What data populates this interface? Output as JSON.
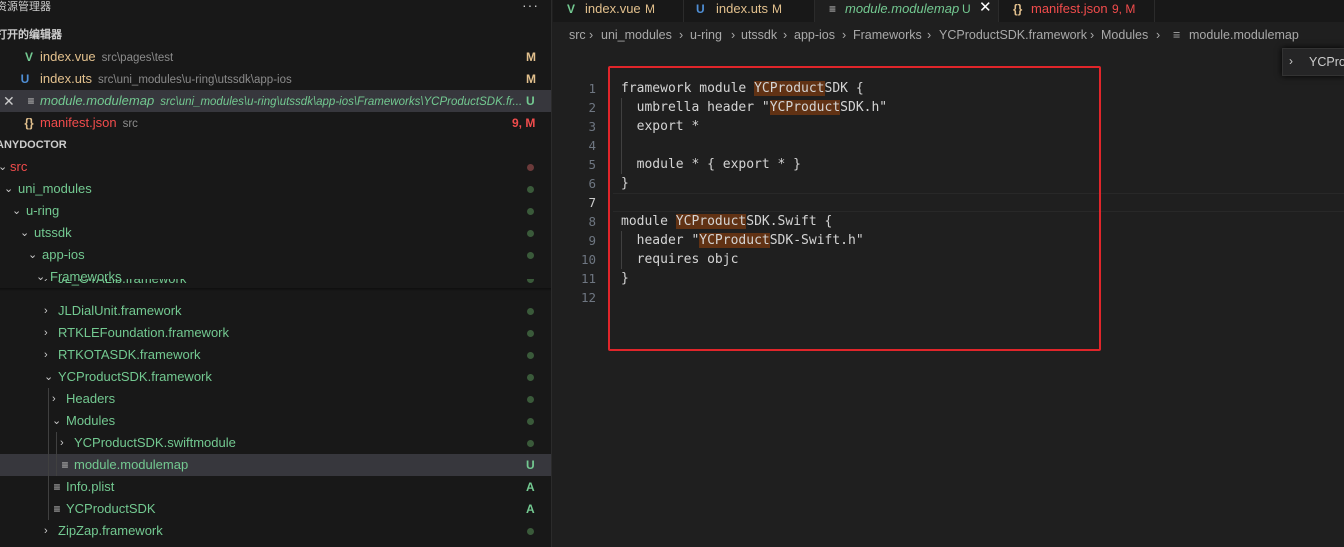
{
  "sidebar": {
    "title": "资源管理器",
    "more": "···",
    "open_editors_title": "打开的编辑器",
    "open_editors": [
      {
        "name": "index.vue",
        "path": "src\\pages\\test",
        "badge": "M"
      },
      {
        "name": "index.uts",
        "path": "src\\uni_modules\\u-ring\\utssdk\\app-ios",
        "badge": "M"
      },
      {
        "name": "module.modulemap",
        "path": "src\\uni_modules\\u-ring\\utssdk\\app-ios\\Frameworks\\YCProductSDK.fr...",
        "badge": "U",
        "close": "✕"
      },
      {
        "name": "manifest.json",
        "path": "src",
        "badge": "9, M"
      }
    ],
    "project_title": "ANYDOCTOR",
    "tree": [
      {
        "label": "src"
      },
      {
        "label": "uni_modules"
      },
      {
        "label": "u-ring"
      },
      {
        "label": "utssdk"
      },
      {
        "label": "app-ios"
      },
      {
        "label": "Frameworks"
      },
      {
        "label": "JL_OTALib.framework"
      },
      {
        "label": "JLDialUnit.framework"
      },
      {
        "label": "RTKLEFoundation.framework"
      },
      {
        "label": "RTKOTASDK.framework"
      },
      {
        "label": "YCProductSDK.framework"
      },
      {
        "label": "Headers"
      },
      {
        "label": "Modules"
      },
      {
        "label": "YCProductSDK.swiftmodule"
      },
      {
        "label": "module.modulemap",
        "badge": "U"
      },
      {
        "label": "Info.plist",
        "badge": "A"
      },
      {
        "label": "YCProductSDK",
        "badge": "A"
      },
      {
        "label": "ZipZap.framework"
      }
    ]
  },
  "tabs": [
    {
      "name": "index.vue",
      "badge": "M"
    },
    {
      "name": "index.uts",
      "badge": "M"
    },
    {
      "name": "module.modulemap",
      "badge": "U",
      "close": "✕"
    },
    {
      "name": "manifest.json",
      "badge": "9, M"
    }
  ],
  "breadcrumb": [
    "src",
    "uni_modules",
    "u-ring",
    "utssdk",
    "app-ios",
    "Frameworks",
    "YCProductSDK.framework",
    "Modules",
    "module.modulemap"
  ],
  "peek": {
    "label": "YCPro"
  },
  "code": {
    "line_numbers": [
      "1",
      "2",
      "3",
      "4",
      "5",
      "6",
      "7",
      "8",
      "9",
      "10",
      "11",
      "12"
    ],
    "lines": [
      {
        "pre": "framework module ",
        "hl": "YCProduct",
        "post": "SDK {"
      },
      {
        "pre": "  umbrella header \"",
        "hl": "YCProduct",
        "post": "SDK.h\""
      },
      {
        "pre": "  export *",
        "hl": "",
        "post": ""
      },
      {
        "pre": "",
        "hl": "",
        "post": ""
      },
      {
        "pre": "  module * { export * }",
        "hl": "",
        "post": ""
      },
      {
        "pre": "}",
        "hl": "",
        "post": ""
      },
      {
        "pre": "",
        "hl": "",
        "post": ""
      },
      {
        "pre": "module ",
        "hl": "YCProduct",
        "post": "SDK.Swift {"
      },
      {
        "pre": "  header \"",
        "hl": "YCProduct",
        "post": "SDK-Swift.h\""
      },
      {
        "pre": "  requires objc",
        "hl": "",
        "post": ""
      },
      {
        "pre": "}",
        "hl": "",
        "post": ""
      },
      {
        "pre": "",
        "hl": "",
        "post": ""
      }
    ],
    "current_line": "7"
  },
  "colors": {
    "modified": "#e2c08d",
    "untracked": "#73c991",
    "error": "#f14c4c",
    "highlight": "#613214",
    "annotation_box": "#e0252a"
  },
  "icons": {
    "vue": "vue-icon",
    "uts": "uts-icon",
    "modulemap": "file-lines-icon",
    "json": "json-braces-icon",
    "chevron": "chevron-icon"
  }
}
